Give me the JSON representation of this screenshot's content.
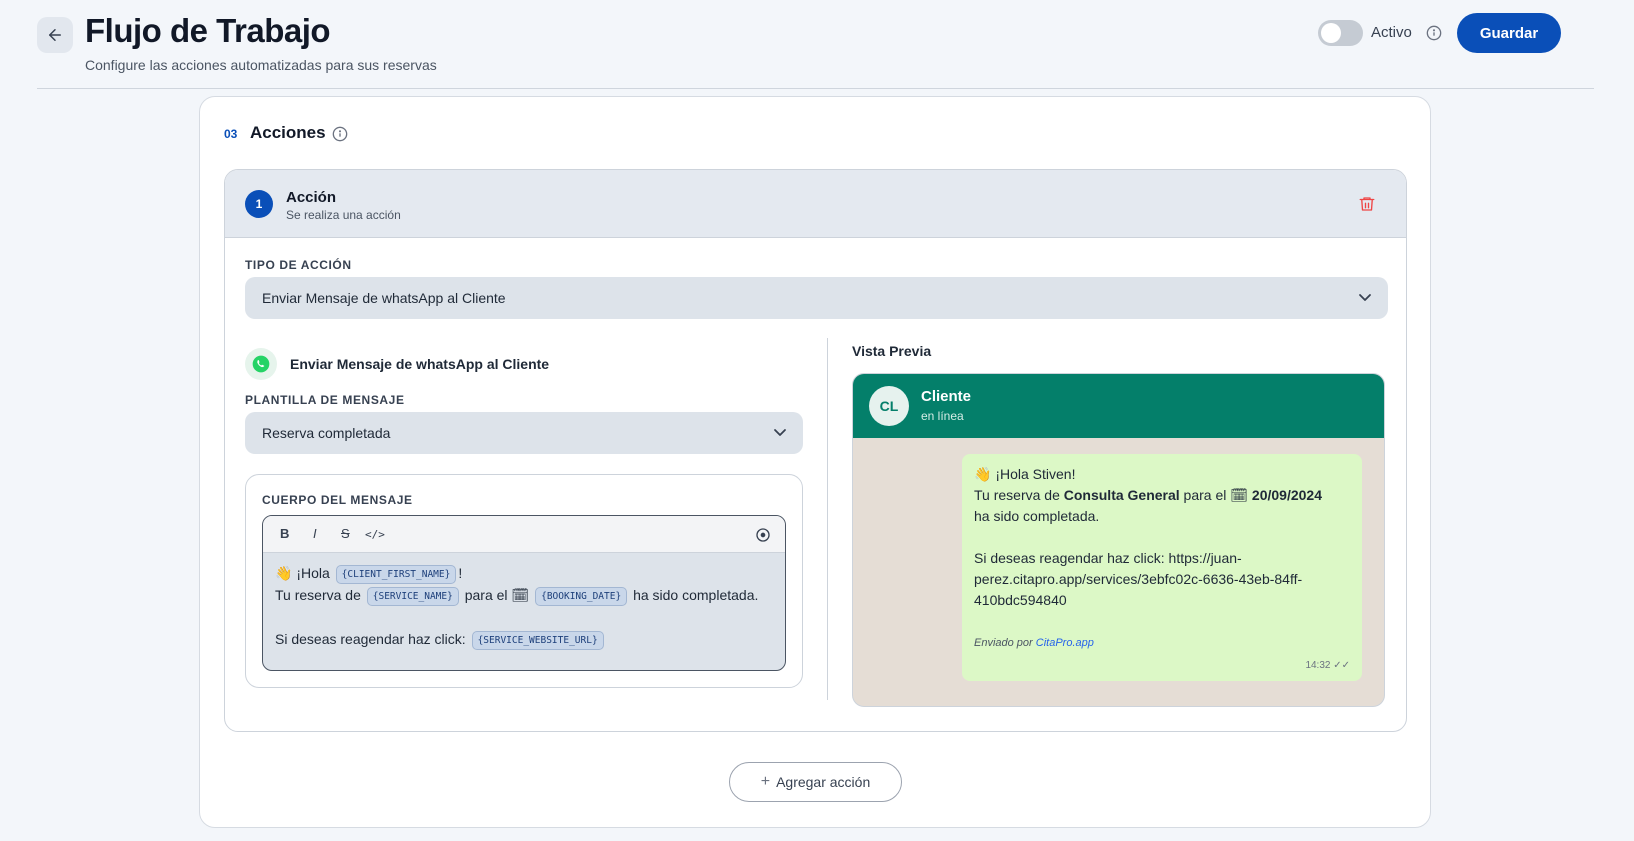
{
  "header": {
    "title": "Flujo de Trabajo",
    "subtitle": "Configure las acciones automatizadas para sus reservas",
    "toggle_label": "Activo",
    "toggle_on": false,
    "save_label": "Guardar"
  },
  "section": {
    "number": "03",
    "title": "Acciones"
  },
  "action": {
    "index": "1",
    "title": "Acción",
    "subtitle": "Se realiza una acción",
    "type_label": "TIPO DE ACCIÓN",
    "type_value": "Enviar Mensaje de whatsApp al Cliente",
    "channel_title": "Enviar Mensaje de whatsApp al Cliente",
    "template_label": "PLANTILLA DE MENSAJE",
    "template_value": "Reserva completada",
    "body_label": "CUERPO DEL MENSAJE",
    "toolbar": {
      "bold": "B",
      "italic": "I",
      "strike": "S",
      "code": "</>"
    },
    "body": {
      "l1_prefix": "👋 ¡Hola",
      "l1_var": "{CLIENT_FIRST_NAME}",
      "l1_suffix": "!",
      "l2_prefix": "Tu reserva de",
      "l2_var1": "{SERVICE_NAME}",
      "l2_mid": "para el 🗓",
      "l2_var2": "{BOOKING_DATE}",
      "l2_suffix": "ha sido completada.",
      "l3_prefix": "Si deseas reagendar haz click:",
      "l3_var": "{SERVICE_WEBSITE_URL}"
    }
  },
  "preview": {
    "title": "Vista Previa",
    "avatar_initials": "CL",
    "contact_name": "Cliente",
    "contact_status": "en línea",
    "msg": {
      "l1": "👋 ¡Hola Stiven!",
      "l2_a": "Tu reserva de ",
      "l2_service": "Consulta General",
      "l2_b": " para el 🗓 ",
      "l2_date": "20/09/2024",
      "l3": "ha sido completada.",
      "l5": "Si deseas reagendar haz click: https://juan-",
      "l6": "perez.citapro.app/services/3ebfc02c-6636-43eb-84ff-",
      "l7": "410bdc594840",
      "sent_by": "Enviado por",
      "sent_by_link": "CitaPro.app",
      "time": "14:32 ✓✓"
    }
  },
  "add_action_label": "Agregar acción",
  "colors": {
    "primary": "#0a4fb8",
    "whatsapp_header": "#047f6a",
    "bubble": "#dcf8c6",
    "danger": "#ef4444"
  }
}
